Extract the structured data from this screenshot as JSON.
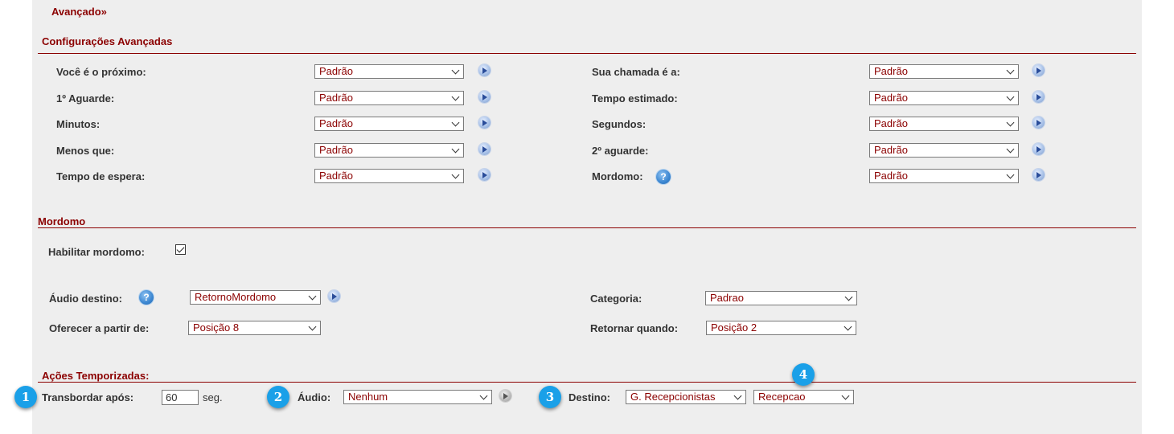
{
  "breadcrumb": {
    "label": "Avançado",
    "arrow": "»"
  },
  "advanced": {
    "title": "Configurações Avançadas",
    "rows": [
      {
        "left": {
          "label": "Você é o próximo:",
          "value": "Padrão"
        },
        "right": {
          "label": "Sua chamada é a:",
          "value": "Padrão"
        }
      },
      {
        "left": {
          "label": "1º Aguarde:",
          "value": "Padrão"
        },
        "right": {
          "label": "Tempo estimado:",
          "value": "Padrão"
        }
      },
      {
        "left": {
          "label": "Minutos:",
          "value": "Padrão"
        },
        "right": {
          "label": "Segundos:",
          "value": "Padrão"
        }
      },
      {
        "left": {
          "label": "Menos que:",
          "value": "Padrão"
        },
        "right": {
          "label": "2º aguarde:",
          "value": "Padrão"
        }
      },
      {
        "left": {
          "label": "Tempo de espera:",
          "value": "Padrão"
        },
        "right": {
          "label": "Mordomo:",
          "value": "Padrão"
        }
      }
    ]
  },
  "mordomo": {
    "title": "Mordomo",
    "enable_label": "Habilitar mordomo:",
    "enabled": true,
    "audio_destino": {
      "label": "Áudio destino:",
      "value": "RetornoMordomo"
    },
    "categoria": {
      "label": "Categoria:",
      "value": "Padrao"
    },
    "oferecer": {
      "label": "Oferecer a partir de:",
      "value": "Posição 8"
    },
    "retornar": {
      "label": "Retornar quando:",
      "value": "Posição 2"
    }
  },
  "acoes": {
    "title": "Ações Temporizadas:",
    "transbordar_label": "Transbordar após:",
    "transbordar_value": "60",
    "transbordar_unit": "seg.",
    "audio_label": "Áudio:",
    "audio_value": "Nenhum",
    "destino_label": "Destino:",
    "destino_type": "G. Recepcionistas",
    "destino_value": "Recepcao"
  },
  "badges": [
    "1",
    "2",
    "3",
    "4"
  ],
  "icons": {
    "play": "play-icon",
    "help": "help-icon",
    "help_glyph": "?"
  },
  "colors": {
    "accent": "#8b0000",
    "panel": "#eeeeee",
    "badge": "#1aa0e8"
  }
}
